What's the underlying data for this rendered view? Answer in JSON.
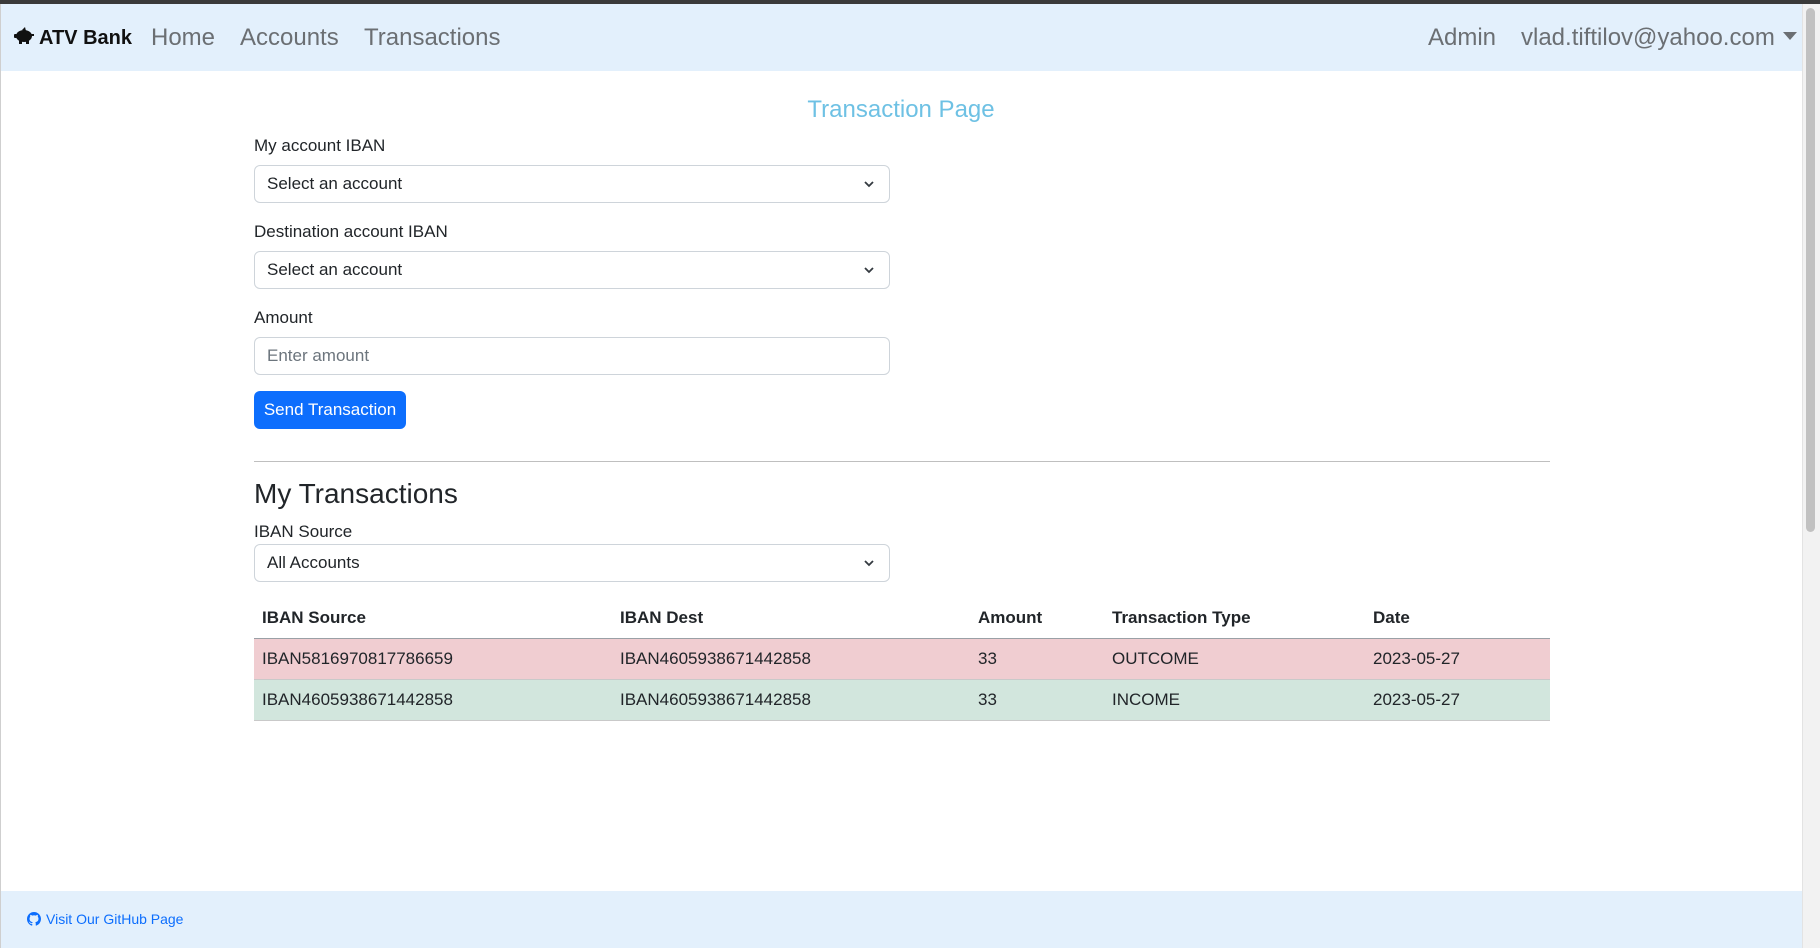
{
  "navbar": {
    "brand": "ATV Bank",
    "brand_icon": "piggy-bank-icon",
    "links": [
      "Home",
      "Accounts",
      "Transactions"
    ],
    "admin": "Admin",
    "user_email": "vlad.tiftilov@yahoo.com"
  },
  "page_title": "Transaction Page",
  "form": {
    "source_label": "My account IBAN",
    "source_value": "Select an account",
    "dest_label": "Destination account IBAN",
    "dest_value": "Select an account",
    "amount_label": "Amount",
    "amount_placeholder": "Enter amount",
    "submit_label": "Send Transaction"
  },
  "transactions": {
    "title": "My Transactions",
    "filter_label": "IBAN Source",
    "filter_value": "All Accounts",
    "columns": [
      "IBAN Source",
      "IBAN Dest",
      "Amount",
      "Transaction Type",
      "Date"
    ],
    "rows": [
      [
        "IBAN5816970817786659",
        "IBAN4605938671442858",
        "33",
        "OUTCOME",
        "2023-05-27"
      ],
      [
        "IBAN4605938671442858",
        "IBAN4605938671442858",
        "33",
        "INCOME",
        "2023-05-27"
      ]
    ]
  },
  "footer": {
    "github_label": "Visit Our GitHub Page",
    "github_icon": "github-icon"
  },
  "colors": {
    "navbar_bg": "#e3f0fc",
    "title": "#6ec1e4",
    "primary": "#0d6efd",
    "outcome_row": "#f0cdd1",
    "income_row": "#d2e6dd"
  }
}
